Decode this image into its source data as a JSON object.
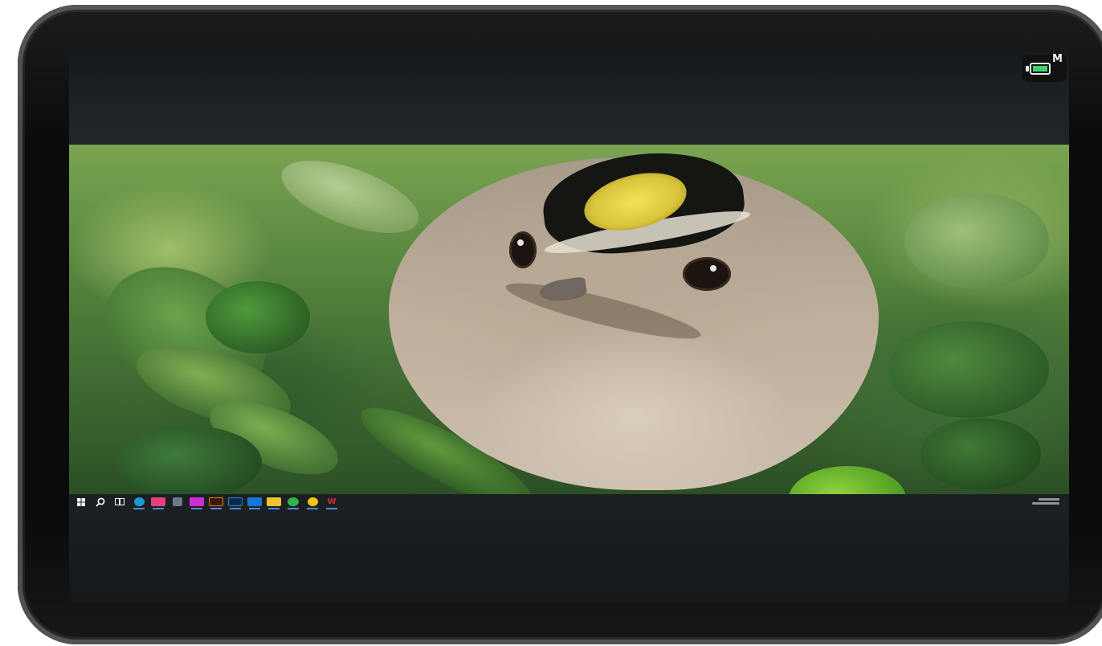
{
  "status_overlay": {
    "battery_mode_letter": "M",
    "battery_level_fraction": 1.0
  },
  "taskbar": {
    "start_icon": "windows-start-icon",
    "search_icon": "search-icon",
    "task_view_icon": "task-view-icon",
    "pinned_apps": [
      {
        "name": "edge-icon",
        "color": "#1a9bd7"
      },
      {
        "name": "store-icon",
        "color": "#e8407a"
      },
      {
        "name": "widgets-icon",
        "color": "#6a7a86"
      },
      {
        "name": "adobe-xd-icon",
        "color": "#cc2fd0"
      },
      {
        "name": "adobe-illustrator-icon",
        "color": "#e37a1d"
      },
      {
        "name": "photoshop-icon",
        "color": "#2f86d8"
      },
      {
        "name": "photos-icon",
        "color": "#1677d6"
      },
      {
        "name": "file-explorer-icon",
        "color": "#f1c232"
      },
      {
        "name": "wechat-icon",
        "color": "#2fb64a"
      },
      {
        "name": "chrome-icon",
        "color": "#f0c419"
      },
      {
        "name": "wps-icon",
        "color": "#d92b2b"
      }
    ]
  },
  "wallpaper": {
    "subject": "bird-in-foliage"
  },
  "colors": {
    "taskbar_bg": "#1b1f22",
    "accent_underline": "#4f88d8",
    "battery_fill": "#39d36a"
  }
}
